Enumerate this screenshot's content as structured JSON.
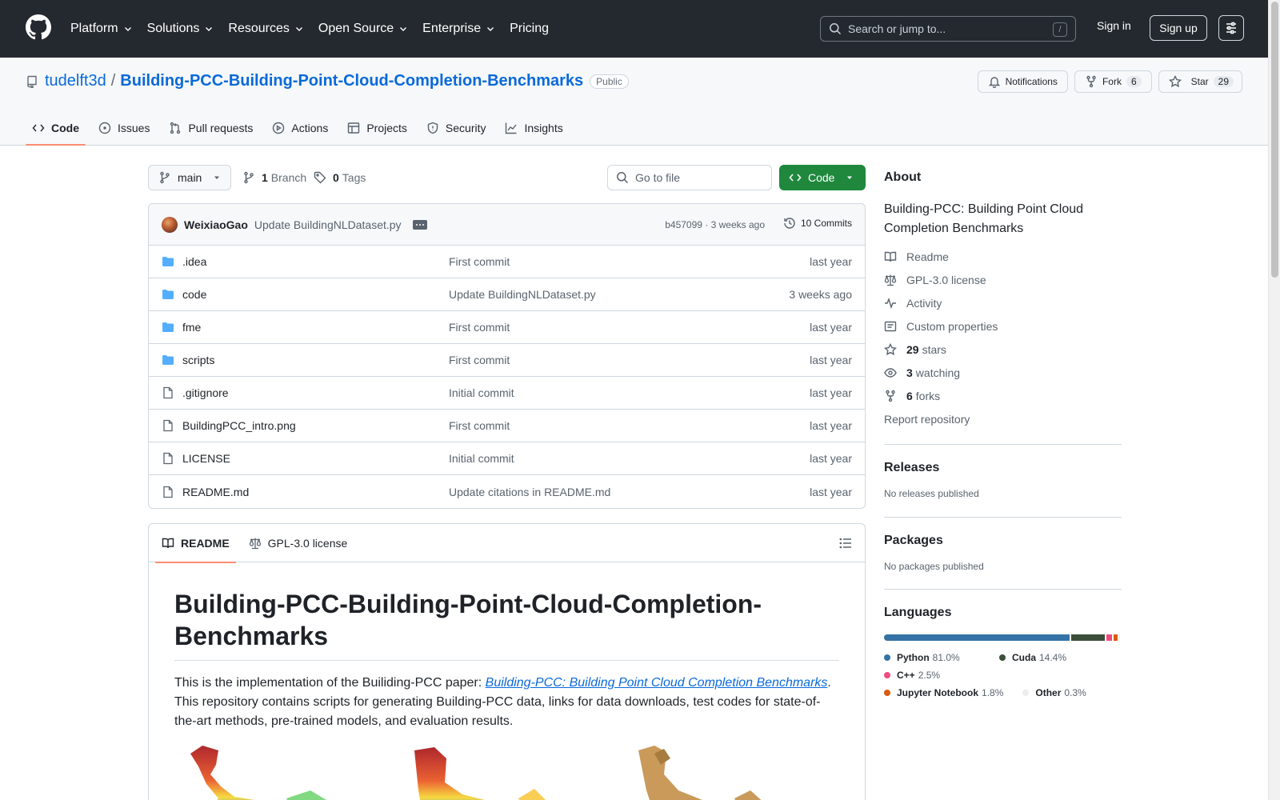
{
  "header": {
    "nav": [
      {
        "label": "Platform",
        "dropdown": true
      },
      {
        "label": "Solutions",
        "dropdown": true
      },
      {
        "label": "Resources",
        "dropdown": true
      },
      {
        "label": "Open Source",
        "dropdown": true
      },
      {
        "label": "Enterprise",
        "dropdown": true
      },
      {
        "label": "Pricing",
        "dropdown": false
      }
    ],
    "search_placeholder": "Search or jump to...",
    "search_shortcut": "/",
    "signin": "Sign in",
    "signup": "Sign up"
  },
  "repo": {
    "owner": "tudelft3d",
    "separator": "/",
    "name": "Building-PCC-Building-Point-Cloud-Completion-Benchmarks",
    "visibility": "Public",
    "notifications_label": "Notifications",
    "fork_label": "Fork",
    "fork_count": "6",
    "star_label": "Star",
    "star_count": "29",
    "tabs": [
      {
        "label": "Code",
        "icon": "code-icon",
        "active": true
      },
      {
        "label": "Issues",
        "icon": "issue-icon",
        "active": false
      },
      {
        "label": "Pull requests",
        "icon": "pull-request-icon",
        "active": false
      },
      {
        "label": "Actions",
        "icon": "play-icon",
        "active": false
      },
      {
        "label": "Projects",
        "icon": "table-icon",
        "active": false
      },
      {
        "label": "Security",
        "icon": "shield-icon",
        "active": false
      },
      {
        "label": "Insights",
        "icon": "graph-icon",
        "active": false
      }
    ]
  },
  "toolbar": {
    "branch": "main",
    "branch_count": "1",
    "branch_label": "Branch",
    "tag_count": "0",
    "tag_label": "Tags",
    "goto_placeholder": "Go to file",
    "code_label": "Code"
  },
  "last_commit": {
    "author": "WeixiaoGao",
    "message": "Update BuildingNLDataset.py",
    "sha_time": "b457099 · 3 weeks ago",
    "commits": "10 Commits"
  },
  "files": [
    {
      "name": ".idea",
      "type": "folder",
      "message": "First commit",
      "time": "last year"
    },
    {
      "name": "code",
      "type": "folder",
      "message": "Update BuildingNLDataset.py",
      "time": "3 weeks ago"
    },
    {
      "name": "fme",
      "type": "folder",
      "message": "First commit",
      "time": "last year"
    },
    {
      "name": "scripts",
      "type": "folder",
      "message": "First commit",
      "time": "last year"
    },
    {
      "name": ".gitignore",
      "type": "file",
      "message": "Initial commit",
      "time": "last year"
    },
    {
      "name": "BuildingPCC_intro.png",
      "type": "file",
      "message": "First commit",
      "time": "last year"
    },
    {
      "name": "LICENSE",
      "type": "file",
      "message": "Initial commit",
      "time": "last year"
    },
    {
      "name": "README.md",
      "type": "file",
      "message": "Update citations in README.md",
      "time": "last year"
    }
  ],
  "readme": {
    "tab_readme": "README",
    "tab_license": "GPL-3.0 license",
    "title": "Building-PCC-Building-Point-Cloud-Completion-Benchmarks",
    "intro_before": "This is the implementation of the Builiding-PCC paper: ",
    "intro_link": "Building-PCC: Building Point Cloud Completion Benchmarks",
    "intro_after": ". This repository contains scripts for generating Building-PCC data, links for data downloads, test codes for state-of-the-art methods, pre-trained models, and evaluation results."
  },
  "about": {
    "heading": "About",
    "description": "Building-PCC: Building Point Cloud Completion Benchmarks",
    "readme": "Readme",
    "license": "GPL-3.0 license",
    "activity": "Activity",
    "custom_properties": "Custom properties",
    "stars_count": "29",
    "stars_label": "stars",
    "watching_count": "3",
    "watching_label": "watching",
    "forks_count": "6",
    "forks_label": "forks",
    "report": "Report repository"
  },
  "releases": {
    "heading": "Releases",
    "empty": "No releases published"
  },
  "packages": {
    "heading": "Packages",
    "empty": "No packages published"
  },
  "languages": {
    "heading": "Languages",
    "items": [
      {
        "name": "Python",
        "percent": "81.0%",
        "value": 81.0,
        "color": "#3572A5"
      },
      {
        "name": "Cuda",
        "percent": "14.4%",
        "value": 14.4,
        "color": "#3A4E3A"
      },
      {
        "name": "C++",
        "percent": "2.5%",
        "value": 2.5,
        "color": "#f34b7d"
      },
      {
        "name": "Jupyter Notebook",
        "percent": "1.8%",
        "value": 1.8,
        "color": "#DA5B0B"
      },
      {
        "name": "Other",
        "percent": "0.3%",
        "value": 0.3,
        "color": "#ededed"
      }
    ]
  }
}
